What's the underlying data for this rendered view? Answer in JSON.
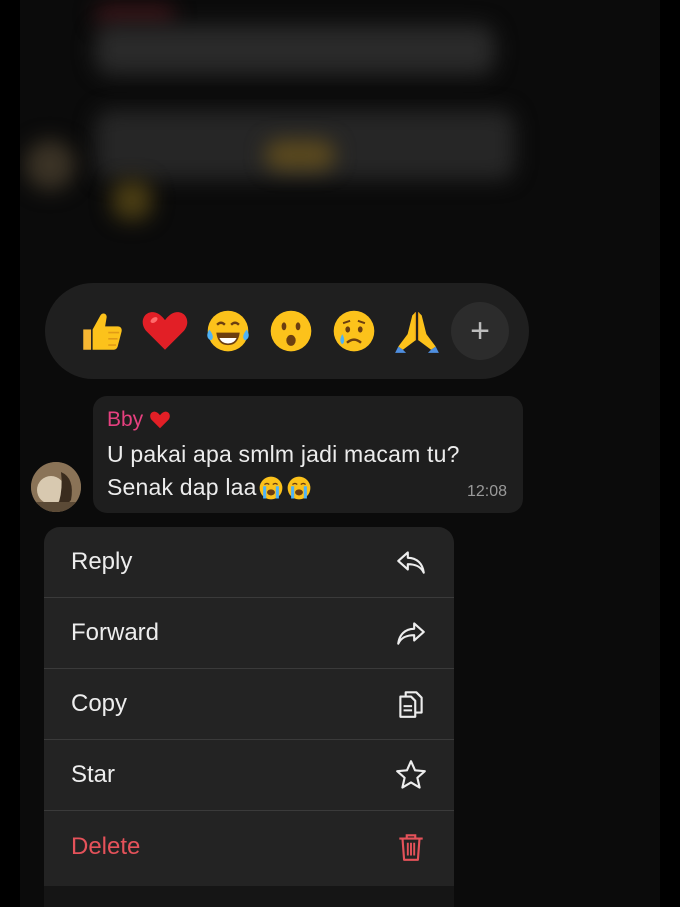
{
  "reactions": [
    {
      "name": "thumbs-up",
      "label": "👍"
    },
    {
      "name": "red-heart",
      "label": "❤️"
    },
    {
      "name": "tears-of-joy",
      "label": "😂"
    },
    {
      "name": "surprised",
      "label": "😮"
    },
    {
      "name": "crying",
      "label": "😢"
    },
    {
      "name": "folded-hands",
      "label": "🙏"
    }
  ],
  "reaction_more": "+",
  "message": {
    "sender": "Bby",
    "line1": "U pakai apa smlm jadi macam tu?",
    "line2": "Senak dap laa",
    "time": "12:08"
  },
  "menu": {
    "items": [
      {
        "label": "Reply",
        "icon": "reply-icon"
      },
      {
        "label": "Forward",
        "icon": "forward-icon"
      },
      {
        "label": "Copy",
        "icon": "copy-icon"
      },
      {
        "label": "Star",
        "icon": "star-icon"
      },
      {
        "label": "Delete",
        "icon": "trash-icon"
      }
    ]
  },
  "colors": {
    "sender": "#e6407f",
    "danger": "#e5525a",
    "bubble": "#1e1e1e",
    "menu": "#232323"
  }
}
